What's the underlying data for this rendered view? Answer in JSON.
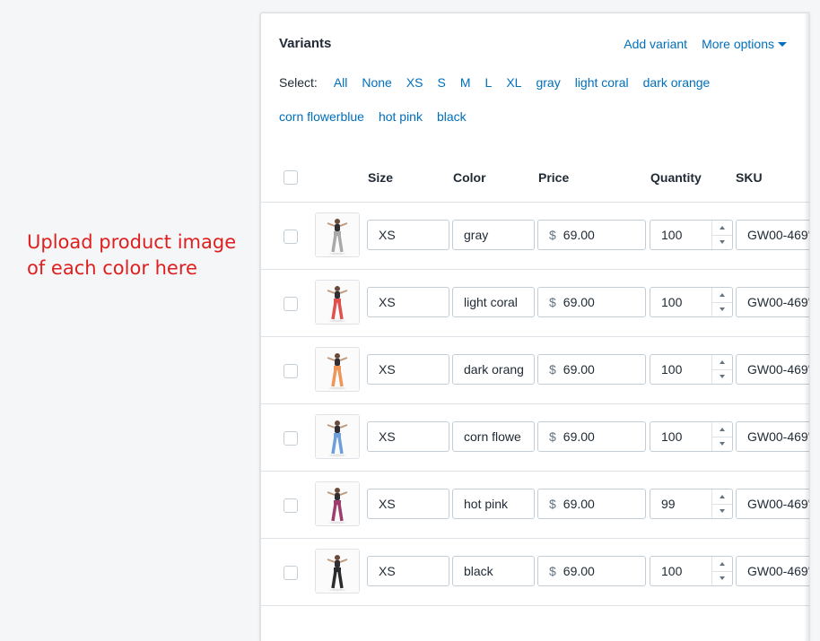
{
  "annotation": {
    "line1": "Upload product image",
    "line2": "of each color here",
    "color": "#de1f1f"
  },
  "card": {
    "title": "Variants",
    "add_variant": "Add variant",
    "more_options": "More options"
  },
  "select": {
    "label": "Select:",
    "options": [
      "All",
      "None",
      "XS",
      "S",
      "M",
      "L",
      "XL",
      "gray",
      "light coral",
      "dark orange",
      "corn flowerblue",
      "hot pink",
      "black"
    ]
  },
  "columns": {
    "size": "Size",
    "color": "Color",
    "price": "Price",
    "quantity": "Quantity",
    "sku": "SKU"
  },
  "currency": "$",
  "rows": [
    {
      "size": "XS",
      "color": "gray",
      "price": "69.00",
      "quantity": "100",
      "sku": "GW00-469'",
      "swatch": "#a9a9a9"
    },
    {
      "size": "XS",
      "color": "light coral",
      "price": "69.00",
      "quantity": "100",
      "sku": "GW00-469'",
      "swatch": "#e0504f"
    },
    {
      "size": "XS",
      "color": "dark orang",
      "price": "69.00",
      "quantity": "100",
      "sku": "GW00-469'",
      "swatch": "#f0955a"
    },
    {
      "size": "XS",
      "color": "corn flowe",
      "price": "69.00",
      "quantity": "100",
      "sku": "GW00-469'",
      "swatch": "#6f9fd8"
    },
    {
      "size": "XS",
      "color": "hot pink",
      "price": "69.00",
      "quantity": "99",
      "sku": "GW00-469'",
      "swatch": "#9c3d6e"
    },
    {
      "size": "XS",
      "color": "black",
      "price": "69.00",
      "quantity": "100",
      "sku": "GW00-469'",
      "swatch": "#2b2b2e"
    }
  ],
  "colors": {
    "link": "#006fbb",
    "border": "#dfe3e8",
    "text": "#212b36"
  }
}
